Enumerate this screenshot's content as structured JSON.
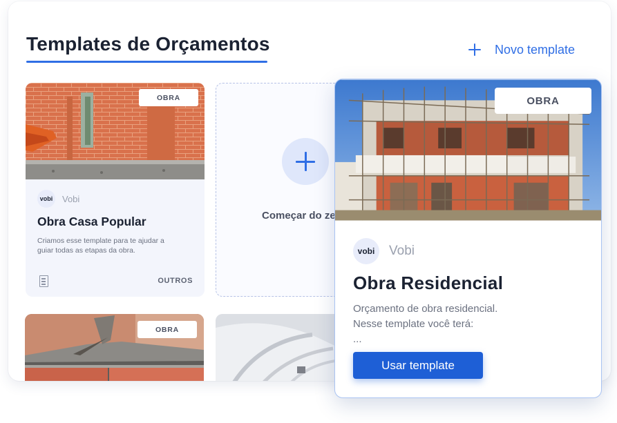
{
  "header": {
    "title": "Templates de Orçamentos",
    "new_template_label": "Novo template"
  },
  "cards": [
    {
      "badge": "OBRA",
      "brand": "Vobi",
      "logo": "vobi",
      "title": "Obra Casa Popular",
      "description": "Criamos esse template para te ajudar a guiar todas as etapas da obra.",
      "category": "OUTROS"
    },
    {
      "start_label": "Começar do zero"
    },
    {
      "badge": "OBRA"
    }
  ],
  "featured": {
    "badge": "OBRA",
    "brand": "Vobi",
    "logo": "vobi",
    "title": "Obra Residencial",
    "description_line1": "Orçamento de obra residencial.",
    "description_line2": "Nesse template você terá:",
    "description_line3": "...",
    "use_button_label": "Usar template"
  },
  "colors": {
    "accent": "#2f6ee5",
    "button": "#1e5fd6",
    "card_bg": "#f3f5fc"
  }
}
